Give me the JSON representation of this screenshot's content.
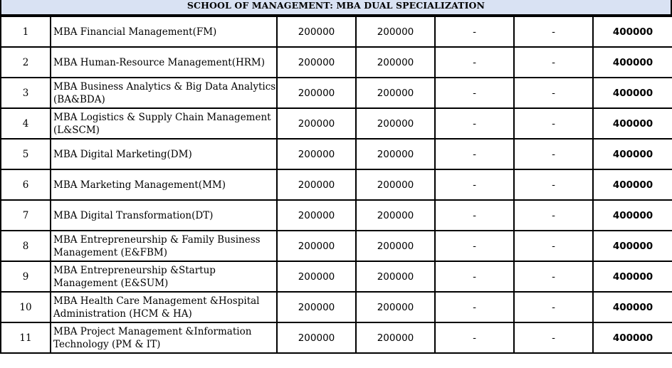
{
  "title": "SCHOOL OF MANAGEMENT: MBA DUAL SPECIALIZATION",
  "rows": [
    {
      "sno": "1",
      "program": "MBA Financial Management(FM)",
      "fee1": "200000",
      "fee2": "200000",
      "fee3": "-",
      "fee4": "-",
      "total": "400000"
    },
    {
      "sno": "2",
      "program": "MBA Human-Resource Management(HRM)",
      "fee1": "200000",
      "fee2": "200000",
      "fee3": "-",
      "fee4": "-",
      "total": "400000"
    },
    {
      "sno": "3",
      "program": "MBA Business Analytics & Big Data Analytics (BA&BDA)",
      "fee1": "200000",
      "fee2": "200000",
      "fee3": "-",
      "fee4": "-",
      "total": "400000"
    },
    {
      "sno": "4",
      "program": "MBA Logistics & Supply Chain Management (L&SCM)",
      "fee1": "200000",
      "fee2": "200000",
      "fee3": "-",
      "fee4": "-",
      "total": "400000"
    },
    {
      "sno": "5",
      "program": "MBA Digital Marketing(DM)",
      "fee1": "200000",
      "fee2": "200000",
      "fee3": "-",
      "fee4": "-",
      "total": "400000"
    },
    {
      "sno": "6",
      "program": "MBA Marketing Management(MM)",
      "fee1": "200000",
      "fee2": "200000",
      "fee3": "-",
      "fee4": "-",
      "total": "400000"
    },
    {
      "sno": "7",
      "program": "MBA Digital Transformation(DT)",
      "fee1": "200000",
      "fee2": "200000",
      "fee3": "-",
      "fee4": "-",
      "total": "400000"
    },
    {
      "sno": "8",
      "program": "MBA Entrepreneurship & Family Business Management (E&FBM)",
      "fee1": "200000",
      "fee2": "200000",
      "fee3": "-",
      "fee4": "-",
      "total": "400000"
    },
    {
      "sno": "9",
      "program": "MBA Entrepreneurship &Startup Management (E&SUM)",
      "fee1": "200000",
      "fee2": "200000",
      "fee3": "-",
      "fee4": "-",
      "total": "400000"
    },
    {
      "sno": "10",
      "program": "MBA Health Care Management &Hospital Administration (HCM & HA)",
      "fee1": "200000",
      "fee2": "200000",
      "fee3": "-",
      "fee4": "-",
      "total": "400000"
    },
    {
      "sno": "11",
      "program": "MBA Project Management &Information Technology (PM & IT)",
      "fee1": "200000",
      "fee2": "200000",
      "fee3": "-",
      "fee4": "-",
      "total": "400000"
    }
  ]
}
